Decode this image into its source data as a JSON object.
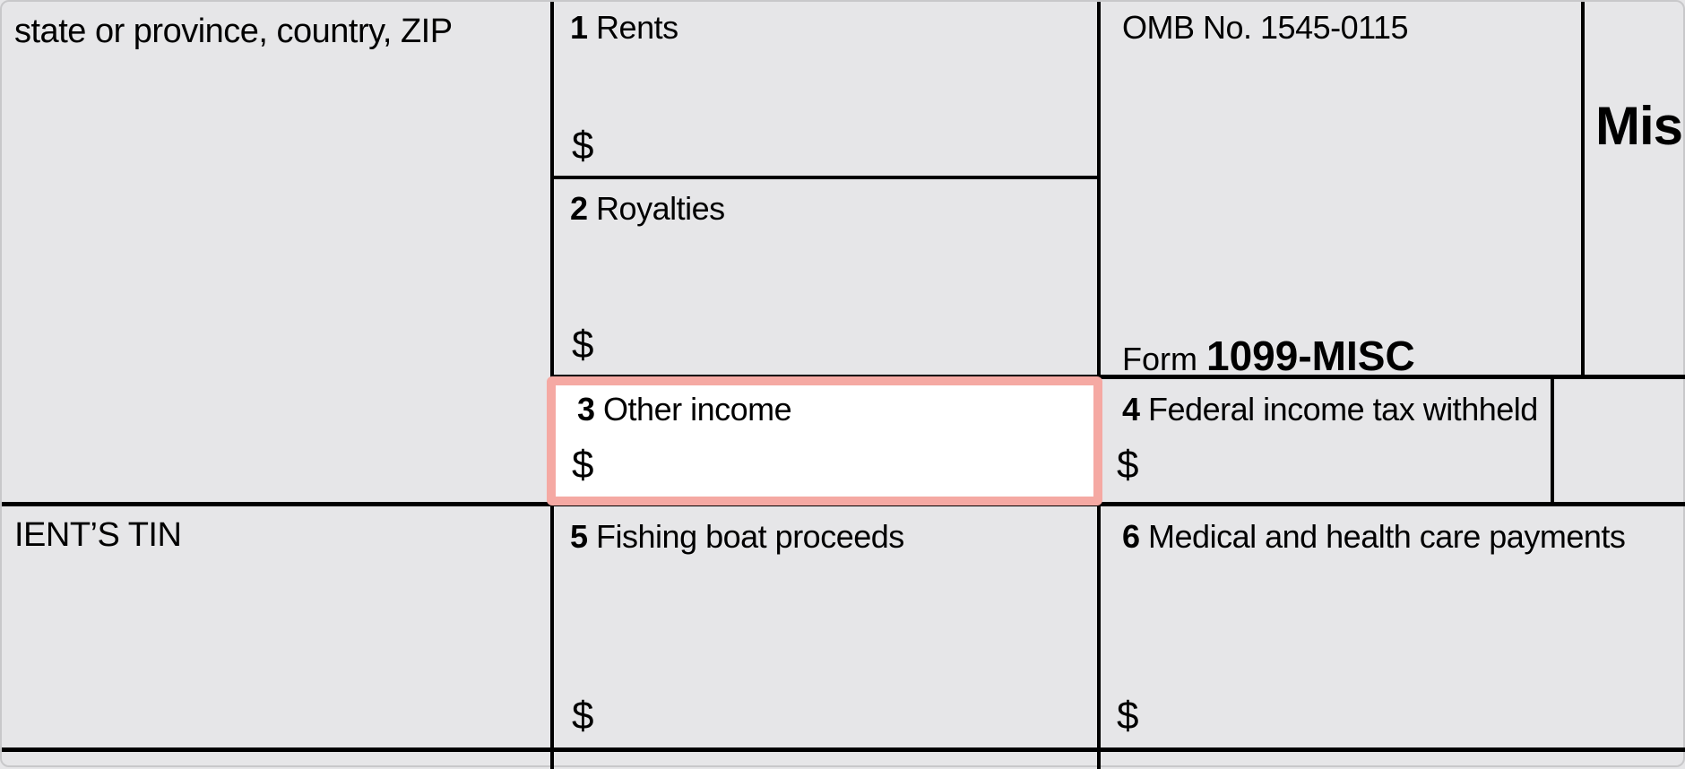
{
  "payer_address_fragment": "state or province, country, ZIP",
  "recipient_tin_label_fragment": "IENT’S TIN",
  "omb_fragment": "OMB No. 1545-0115",
  "form_prefix": "Form",
  "form_number": "1099-MISC",
  "title_fragment": "Mis",
  "currency_symbol": "$",
  "boxes": {
    "b1": {
      "num": "1",
      "label": "Rents"
    },
    "b2": {
      "num": "2",
      "label": "Royalties"
    },
    "b3": {
      "num": "3",
      "label": "Other income"
    },
    "b4": {
      "num": "4",
      "label": "Federal income tax withheld"
    },
    "b5": {
      "num": "5",
      "label": "Fishing boat proceeds"
    },
    "b6": {
      "num": "6",
      "label": "Medical and health care payments"
    }
  }
}
